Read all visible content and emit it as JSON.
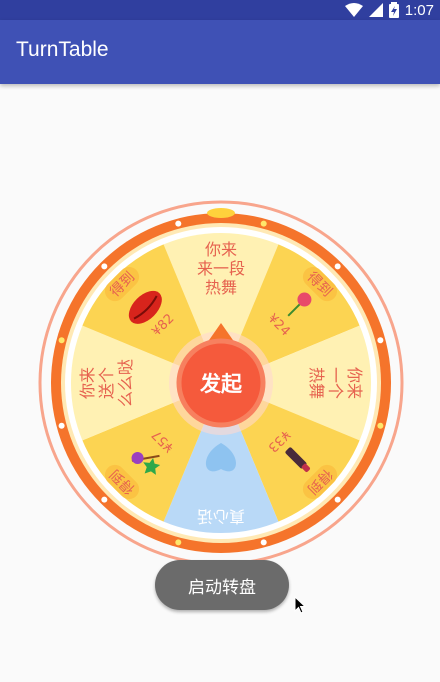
{
  "status_bar": {
    "time": "1:07"
  },
  "app_bar": {
    "title": "TurnTable"
  },
  "wheel": {
    "center_label": "发起",
    "segments": [
      {
        "text": [
          "你来",
          "来一段",
          "热舞"
        ]
      },
      {
        "badge": "得到",
        "price": "¥24",
        "icon": "rose-icon"
      },
      {
        "text": [
          "你来",
          "一个",
          "热舞"
        ]
      },
      {
        "badge": "得到",
        "price": "¥33",
        "icon": "lipstick-icon"
      },
      {
        "text": [
          "真心话"
        ]
      },
      {
        "badge": "得到",
        "price": "¥57",
        "icon": "magic-wand-icon"
      },
      {
        "text": [
          "你来",
          "送个",
          "么么哒"
        ]
      },
      {
        "badge": "得到",
        "price": "¥82",
        "icon": "kiss-lips-icon"
      }
    ]
  },
  "start_button": {
    "label": "启动转盘"
  },
  "colors": {
    "primary": "#3f51b5",
    "primary_dark": "#303f9f",
    "ring": "#f5742b",
    "segment_dark": "#fcd452",
    "segment_light": "#fff1b3",
    "segment_blue": "#b9d9f7",
    "text_red": "#e6624f"
  }
}
